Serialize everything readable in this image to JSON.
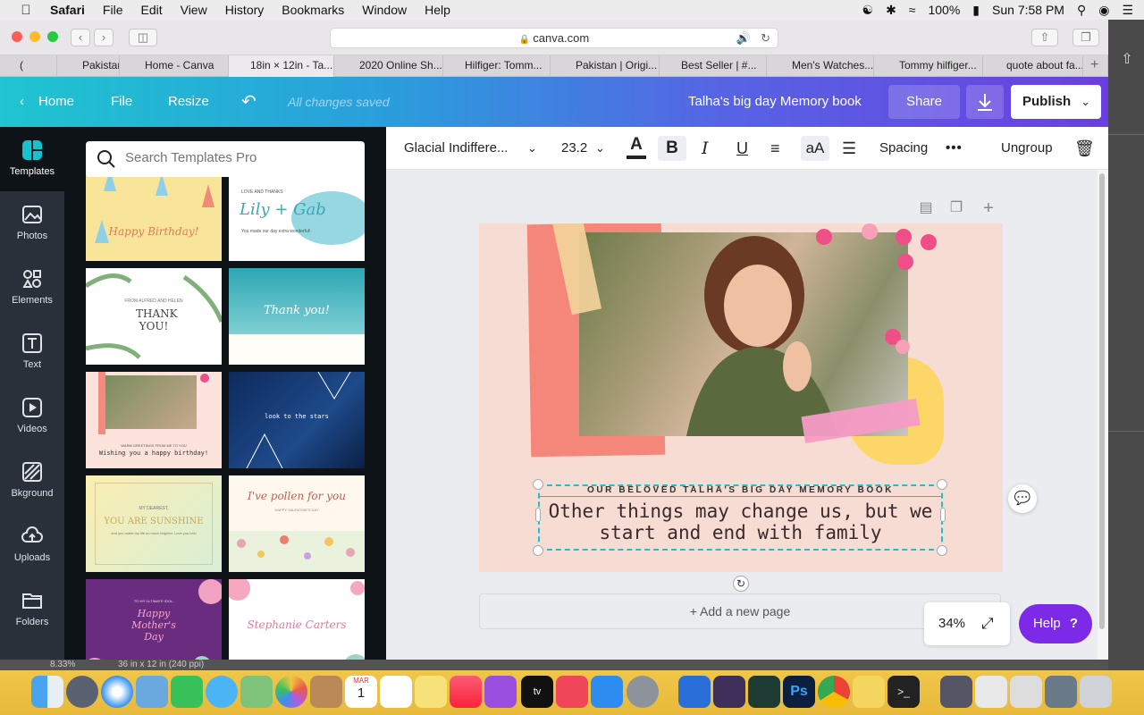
{
  "menubar": {
    "app": "Safari",
    "items": [
      "File",
      "Edit",
      "View",
      "History",
      "Bookmarks",
      "Window",
      "Help"
    ],
    "battery": "100%",
    "clock": "Sun 7:58 PM"
  },
  "browser": {
    "url": "canva.com",
    "tabs": [
      "(",
      "Pakistan",
      "Home - Canva",
      "18in × 12in - Ta...",
      "2020 Online Sh...",
      "Hilfiger: Tomm...",
      "Pakistan | Origi...",
      "Best Seller | #...",
      "Men's Watches...",
      "Tommy hilfiger...",
      "quote about fa..."
    ]
  },
  "canva": {
    "home": "Home",
    "file": "File",
    "resize": "Resize",
    "saved_status": "All changes saved",
    "doc_title": "Talha's big day Memory book",
    "share": "Share",
    "publish": "Publish"
  },
  "rail": [
    {
      "label": "Templates",
      "icon": "templates-icon"
    },
    {
      "label": "Photos",
      "icon": "photos-icon"
    },
    {
      "label": "Elements",
      "icon": "elements-icon"
    },
    {
      "label": "Text",
      "icon": "text-icon"
    },
    {
      "label": "Videos",
      "icon": "videos-icon"
    },
    {
      "label": "Bkground",
      "icon": "background-icon"
    },
    {
      "label": "Uploads",
      "icon": "uploads-icon"
    },
    {
      "label": "Folders",
      "icon": "folders-icon"
    }
  ],
  "search": {
    "placeholder": "Search Templates Pro"
  },
  "templates": {
    "birthday": "Happy Birthday!",
    "lily_top": "LOVE AND THANKS",
    "lily_names": "Lily + Gab",
    "lily_sub": "You made our day extra wonderful!",
    "thankyou_top": "FROM ALFRED AND HELEN",
    "thankyou": "THANK YOU!",
    "watercolor_thanks": "Thank you!",
    "warm_greetings": "WARM GREETINGS FROM ME TO YOU",
    "wishing": "Wishing you a happy birthday!",
    "stars": "look to the stars",
    "dearest": "MY DEAREST,",
    "sunshine": "YOU ARE SUNSHINE",
    "sunshine_sub": "and you make my life so much brighter. Love you lots!",
    "pollen": "I've pollen for you",
    "pollen_sub": "HAPPY VALENTINE'S DAY",
    "mothers_top": "TO MY ULTIMATE IDOL:",
    "mothers": "Happy Mother's Day",
    "stephanie": "Stephanie Carters"
  },
  "toolbar": {
    "font": "Glacial Indiffere...",
    "size": "23.2",
    "case": "aA",
    "spacing": "Spacing",
    "more": "•••",
    "ungroup": "Ungroup"
  },
  "design": {
    "heading": "OUR BELOVED TALHA'S BIG DAY MEMORY BOOK",
    "quote": "Other things may change us, but we start and end with family"
  },
  "editor": {
    "add_page": "+ Add a new page",
    "zoom": "34%",
    "help": "Help"
  },
  "photoshop": {
    "zoom": "8.33%",
    "doc_size": "36 in x 12 in (240 ppi)"
  },
  "dock": {
    "calendar_month": "MAR",
    "calendar_day": "1"
  },
  "colors": {
    "canva_purple": "#7d2ae8",
    "selection": "#13c4cf"
  }
}
